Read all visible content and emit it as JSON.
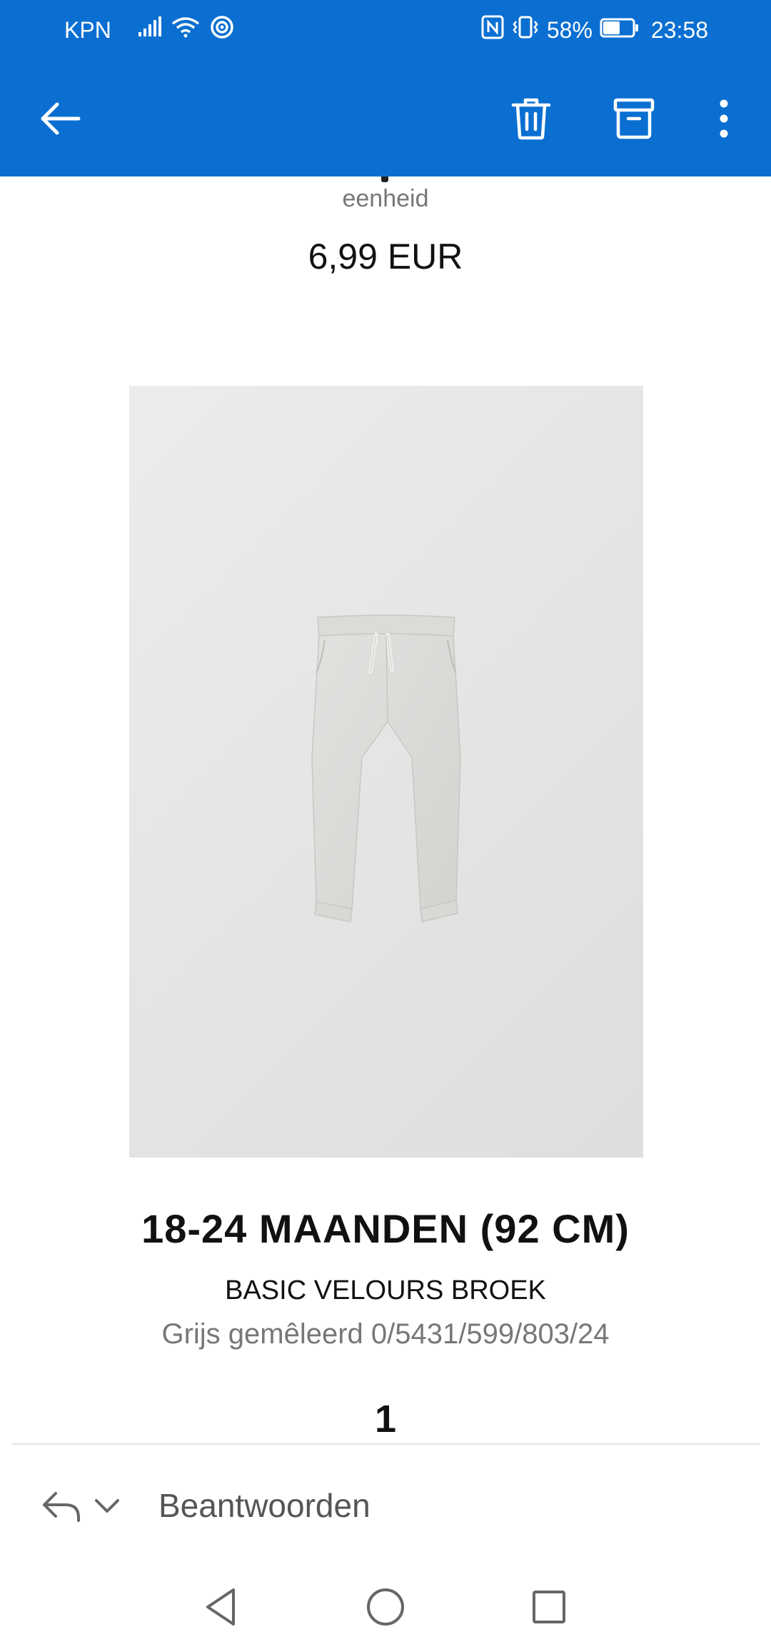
{
  "status_bar": {
    "carrier": "KPN",
    "battery_percent": "58%",
    "time": "23:58",
    "icons": [
      "signal-icon",
      "wifi-icon",
      "hotspot-icon",
      "nfc-icon",
      "vibrate-icon",
      "battery-icon"
    ],
    "battery_level": 0.58
  },
  "toolbar": {
    "icons": [
      "back-arrow-icon",
      "trash-icon",
      "archive-icon",
      "more-vertical-icon"
    ]
  },
  "content": {
    "unit_text": "eenheid",
    "price": "6,99 EUR",
    "size_title": "18-24 MAANDEN (92 CM)",
    "product_name": "BASIC VELOURS BROEK",
    "product_color": "Grijs gemêleerd 0/5431/599/803/24",
    "quantity": "1"
  },
  "reply": {
    "label": "Beantwoorden",
    "icons": [
      "reply-icon",
      "chevron-down-icon"
    ]
  },
  "nav": {
    "icons": [
      "nav-back-icon",
      "nav-home-icon",
      "nav-recents-icon"
    ]
  },
  "colors": {
    "accent": "#0a6fd1",
    "background": "#ffffff",
    "muted_text": "#777777"
  }
}
